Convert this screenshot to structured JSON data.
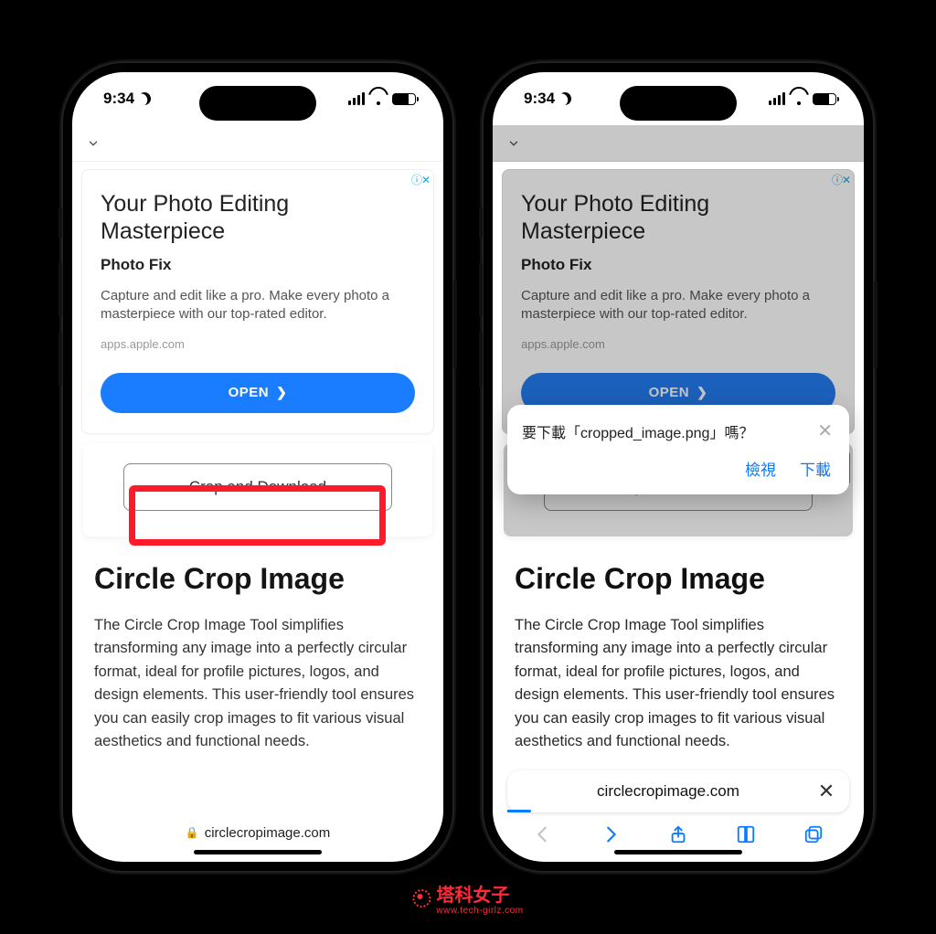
{
  "status": {
    "time": "9:34"
  },
  "ad": {
    "badge": "ⓘ✕",
    "title": "Your Photo Editing Masterpiece",
    "sub": "Photo Fix",
    "desc": "Capture and edit like a pro. Make every photo a masterpiece with our top-rated editor.",
    "domain": "apps.apple.com",
    "open": "OPEN"
  },
  "crop_btn": "Crop and Download",
  "article": {
    "heading": "Circle Crop Image",
    "body": "The Circle Crop Image Tool simplifies transforming any image into a perfectly circular format, ideal for profile pictures, logos, and design elements. This user-friendly tool ensures you can easily crop images to fit various visual aesthetics and functional needs."
  },
  "addr_left": "circlecropimage.com",
  "addr_right": "circlecropimage.com",
  "download": {
    "message": "要下載「cropped_image.png」嗎？",
    "view": "檢視",
    "download": "下載"
  },
  "watermark": {
    "brand": "塔科女子",
    "url": "www.tech-girlz.com"
  }
}
